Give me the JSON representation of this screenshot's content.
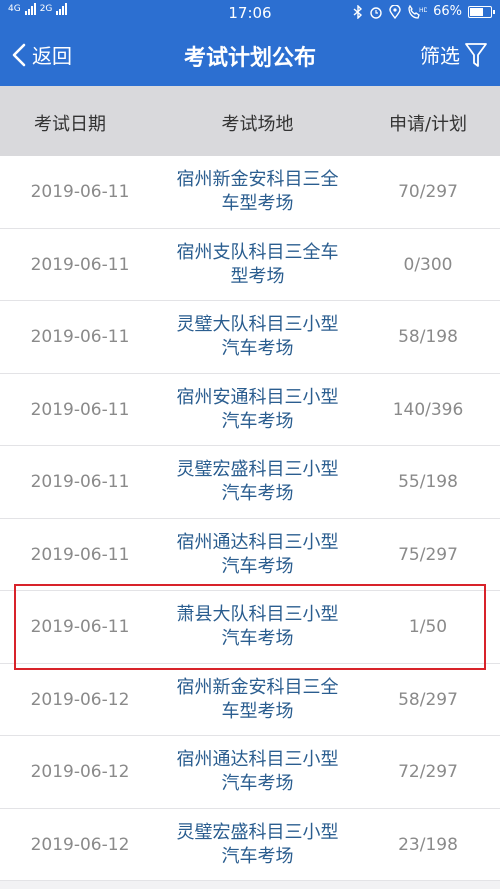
{
  "status_bar": {
    "network_left": "4G",
    "network_right": "2G",
    "time": "17:06",
    "battery": "66%",
    "icons": [
      "bluetooth-icon",
      "alarm-icon",
      "location-icon",
      "hd-call-icon",
      "signal-icon",
      "battery-icon"
    ]
  },
  "nav": {
    "back_label": "返回",
    "title": "考试计划公布",
    "filter_label": "筛选"
  },
  "table": {
    "headers": [
      "考试日期",
      "考试场地",
      "申请/计划"
    ],
    "rows": [
      {
        "date": "2019-06-11",
        "place_line1": "宿州新金安科目三全",
        "place_line2": "车型考场",
        "ratio": "70/297"
      },
      {
        "date": "2019-06-11",
        "place_line1": "宿州支队科目三全车",
        "place_line2": "型考场",
        "ratio": "0/300"
      },
      {
        "date": "2019-06-11",
        "place_line1": "灵璧大队科目三小型",
        "place_line2": "汽车考场",
        "ratio": "58/198"
      },
      {
        "date": "2019-06-11",
        "place_line1": "宿州安通科目三小型",
        "place_line2": "汽车考场",
        "ratio": "140/396"
      },
      {
        "date": "2019-06-11",
        "place_line1": "灵璧宏盛科目三小型",
        "place_line2": "汽车考场",
        "ratio": "55/198"
      },
      {
        "date": "2019-06-11",
        "place_line1": "宿州通达科目三小型",
        "place_line2": "汽车考场",
        "ratio": "75/297"
      },
      {
        "date": "2019-06-11",
        "place_line1": "萧县大队科目三小型",
        "place_line2": "汽车考场",
        "ratio": "1/50"
      },
      {
        "date": "2019-06-12",
        "place_line1": "宿州新金安科目三全",
        "place_line2": "车型考场",
        "ratio": "58/297"
      },
      {
        "date": "2019-06-12",
        "place_line1": "宿州通达科目三小型",
        "place_line2": "汽车考场",
        "ratio": "72/297"
      },
      {
        "date": "2019-06-12",
        "place_line1": "灵璧宏盛科目三小型",
        "place_line2": "汽车考场",
        "ratio": "23/198"
      }
    ]
  },
  "colors": {
    "header_blue": "#2c6fd1",
    "place_text": "#2a5d8f",
    "highlight_red": "#d8232a"
  }
}
